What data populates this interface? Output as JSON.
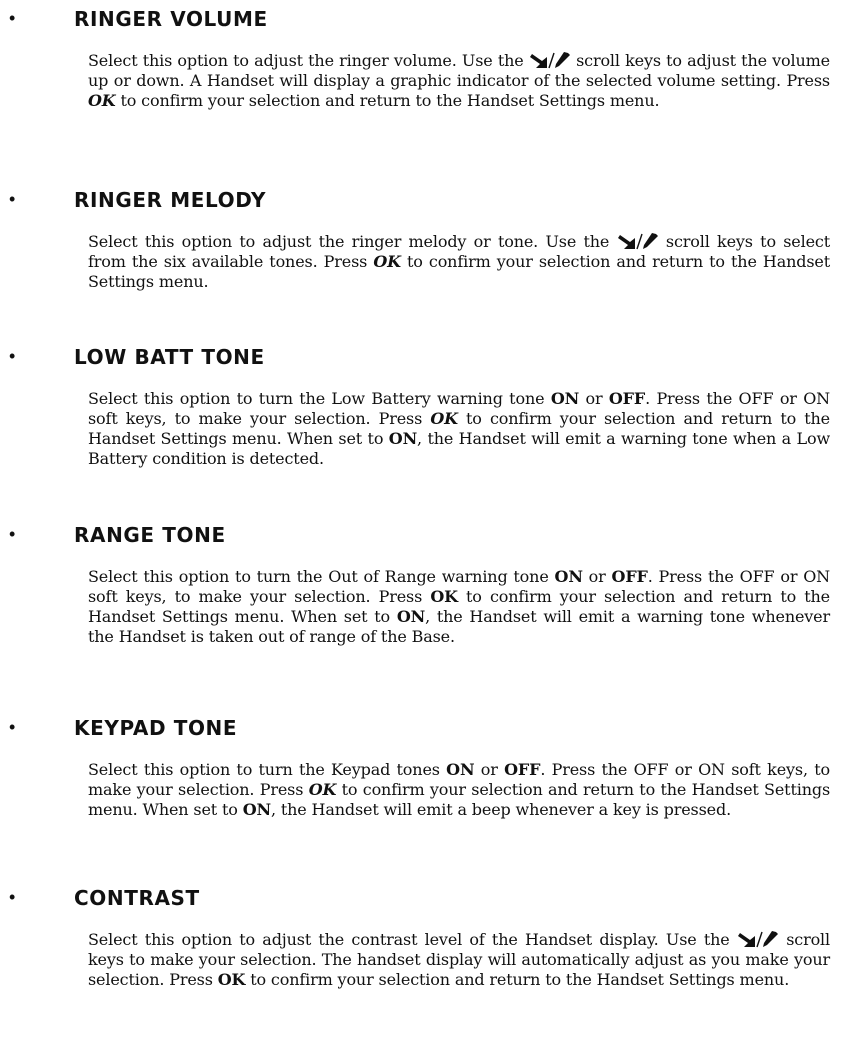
{
  "sections": [
    {
      "bullet": "•",
      "heading": "RINGER VOLUME",
      "text": {
        "t1": "Select this option to adjust the ringer volume.  Use the",
        "t2": "scroll keys to adjust the volume up or down.  A Handset will display a graphic indicator of the selected volume setting.  Press",
        "ok": "OK",
        "t3": "to confirm your selection and return to the Handset Settings menu."
      }
    },
    {
      "bullet": "•",
      "heading": "RINGER MELODY",
      "text": {
        "t1": "Select this option to adjust the ringer melody or tone.  Use the",
        "t2": "scroll keys to select from the six available tones. Press",
        "ok": "OK",
        "t3": "to confirm your selection and return to the Handset Settings menu."
      }
    },
    {
      "bullet": "•",
      "heading": "LOW BATT TONE",
      "text": {
        "t1": "Select this option to turn the Low Battery warning tone",
        "on1": "ON",
        "t2": "or",
        "off1": "OFF",
        "t3": ".  Press the OFF or ON soft keys, to make your selection. Press",
        "ok": "OK",
        "t4": "to confirm your selection and return to the Handset Settings menu.  When set to",
        "on2": "ON",
        "t5": ", the Handset will emit a warning tone when a Low Battery condition is detected."
      }
    },
    {
      "bullet": "•",
      "heading": "RANGE TONE",
      "text": {
        "t1": "Select this option to turn the Out of Range warning tone",
        "on1": "ON",
        "t2": "or",
        "off1": "OFF",
        "t3": ".  Press the OFF or ON soft keys, to make your selection. Press",
        "ok": "OK",
        "t4": "to confirm your selection and return to the Handset Settings menu.  When set to",
        "on2": "ON",
        "t5": ", the Handset will emit a warning tone whenever the Handset is taken out of range of the Base."
      }
    },
    {
      "bullet": "•",
      "heading": "KEYPAD TONE",
      "text": {
        "t1": "Select this option to turn the Keypad tones",
        "on1": "ON",
        "t2": "or",
        "off1": "OFF",
        "t3": ".  Press the OFF or ON soft keys, to make your selection. Press",
        "ok": "OK",
        "t4": "to confirm your selection and return to the Handset Settings menu.  When set to",
        "on2": "ON",
        "t5": ", the Handset will emit a beep whenever a key is pressed."
      }
    },
    {
      "bullet": "•",
      "heading": "CONTRAST",
      "text": {
        "t1": "Select this option to adjust the contrast level of the Handset display.  Use the",
        "t2": "scroll keys to make your selection.  The handset display will automatically adjust as you make your selection. Press",
        "ok": "OK",
        "t3": "to confirm your selection and return to the Handset Settings menu."
      }
    }
  ],
  "icons": {
    "scroll_keys": "scroll-down-up-arrows-icon"
  }
}
